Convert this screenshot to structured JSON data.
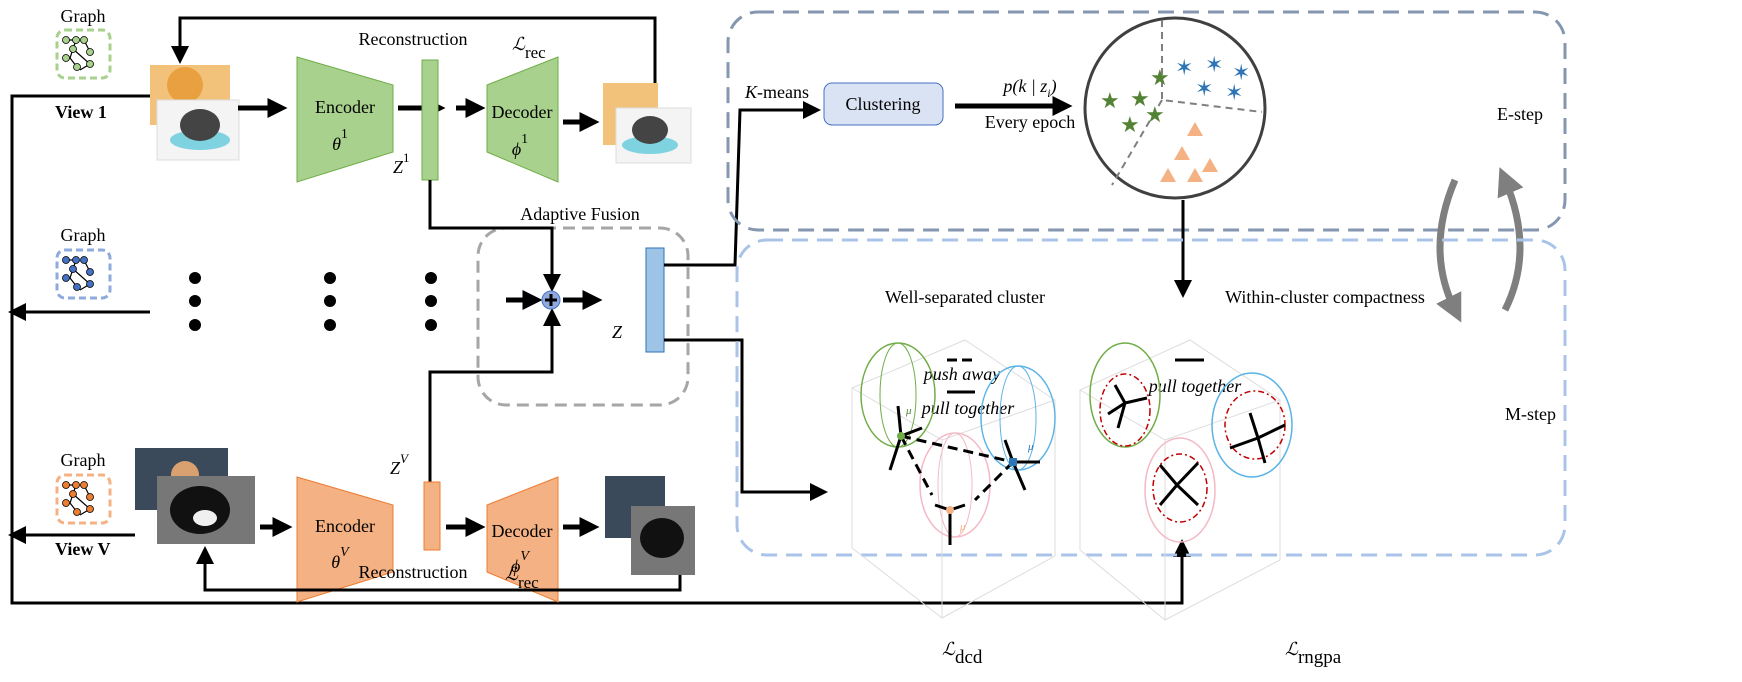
{
  "views": [
    {
      "graph_label": "Graph",
      "view_label": "View 1",
      "encoder_label": "Encoder",
      "encoder_param": "θ",
      "encoder_sup": "1",
      "decoder_label": "Decoder",
      "decoder_param": "ϕ",
      "decoder_sup": "1",
      "latent": "Z",
      "latent_sup": "1",
      "color": "#a9d18e",
      "stroke": "#70ad47"
    },
    {
      "graph_label": "Graph",
      "color": "#4472c4"
    },
    {
      "graph_label": "Graph",
      "view_label": "View V",
      "encoder_label": "Encoder",
      "encoder_param": "θ",
      "encoder_sup": "V",
      "decoder_label": "Decoder",
      "decoder_param": "ϕ",
      "decoder_sup": "V",
      "latent": "Z",
      "latent_sup": "V",
      "color": "#f4b183",
      "stroke": "#ed7d31"
    }
  ],
  "reconstruction": "Reconstruction",
  "loss_rec": {
    "symbol": "ℒ",
    "sub": "rec"
  },
  "fusion": {
    "label": "Adaptive Fusion",
    "output": "Z"
  },
  "estep": {
    "kmeans_k": "K",
    "kmeans_rest": "-means",
    "clustering": "Clustering",
    "prob": "p(k | z",
    "prob_sub": "i",
    "prob_close": ")",
    "every_epoch": "Every epoch",
    "title": "E-step"
  },
  "mstep": {
    "title": "M-step",
    "left_title": "Well-separated cluster",
    "right_title": "Within-cluster compactness",
    "push_away": "push away",
    "pull_together": "pull together",
    "right_pull_together": "pull together",
    "mu": "μ",
    "loss_dcd": {
      "symbol": "ℒ",
      "sub": "dcd"
    },
    "loss_rngpa": {
      "symbol": "ℒ",
      "sub": "rngpa"
    }
  },
  "colors": {
    "green": "#70ad47",
    "blue": "#2e75b6",
    "orange": "#f4b183",
    "estep_border": "#8496b0",
    "mstep_border": "#a9c4e8",
    "fusion_border": "#a6a6a6"
  }
}
